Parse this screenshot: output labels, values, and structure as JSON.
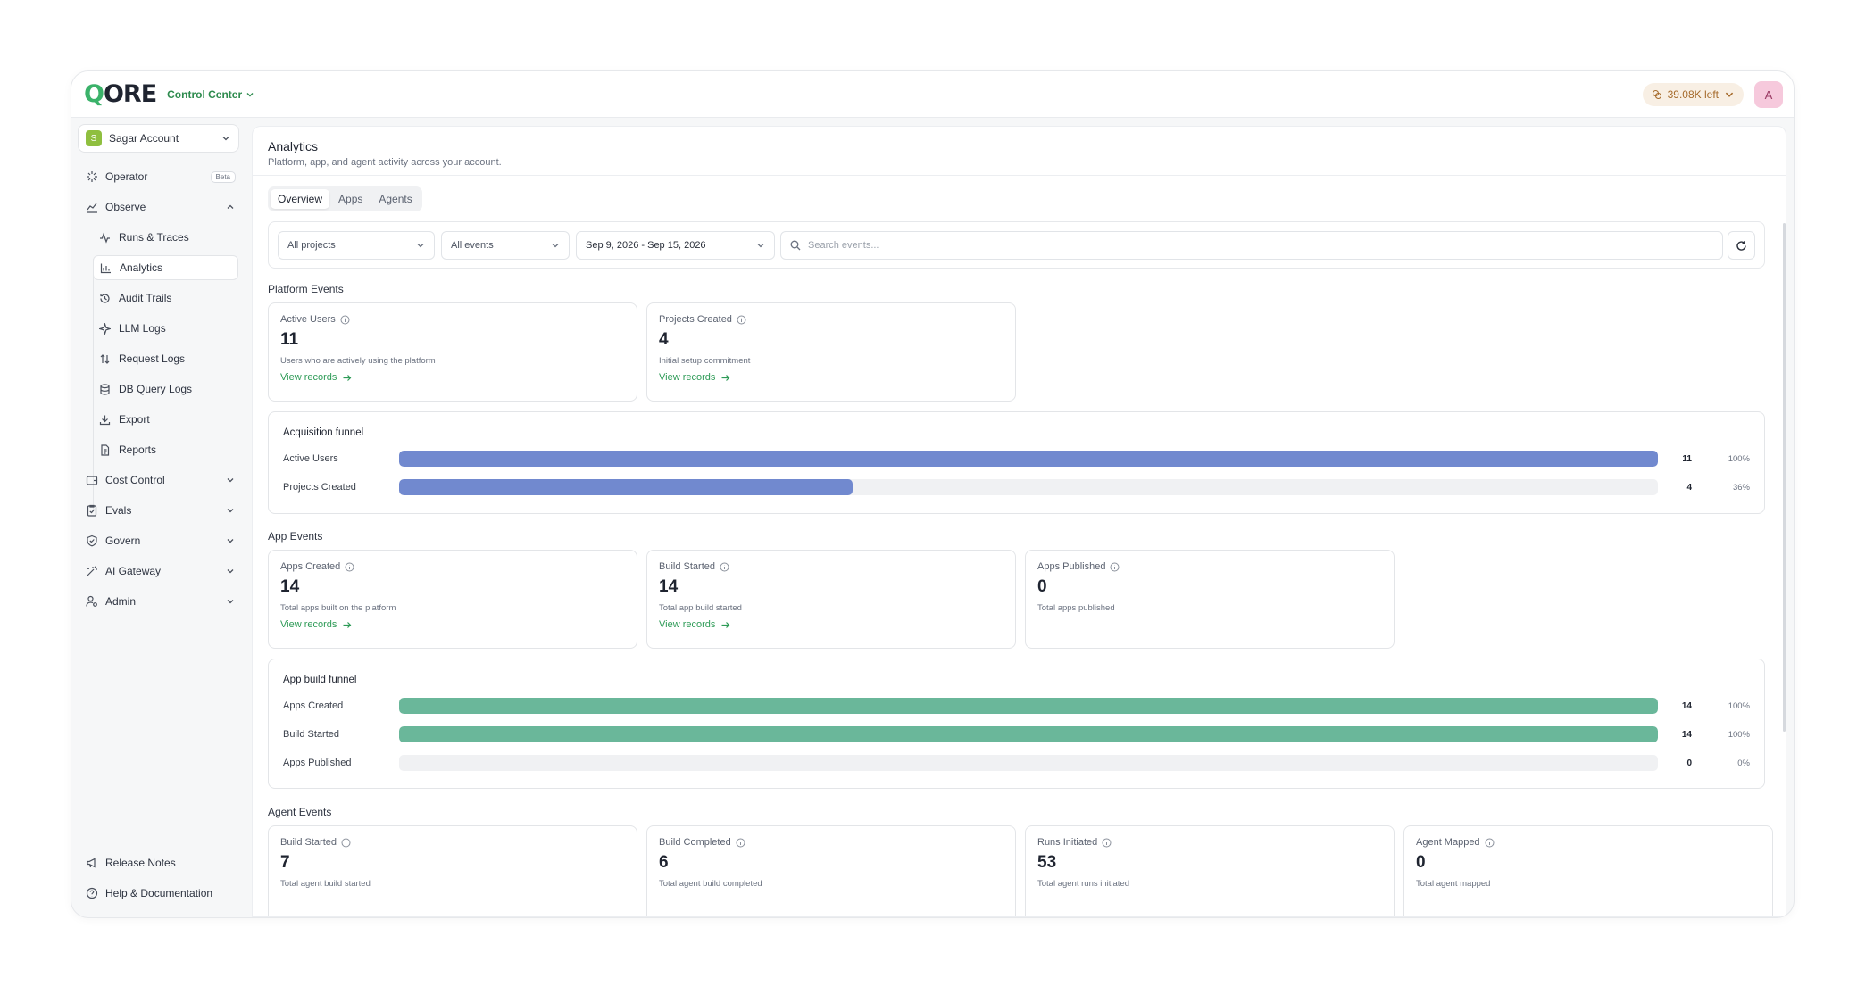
{
  "topbar": {
    "logo_q": "Q",
    "logo_rest": "ORE",
    "section": "Control Center",
    "credits": "39.08K left",
    "avatar": "A"
  },
  "sidebar": {
    "account": {
      "badge": "S",
      "name": "Sagar Account"
    },
    "operator": {
      "label": "Operator",
      "badge": "Beta"
    },
    "observe": {
      "label": "Observe"
    },
    "observe_items": [
      {
        "label": "Runs & Traces"
      },
      {
        "label": "Analytics"
      },
      {
        "label": "Audit Trails"
      },
      {
        "label": "LLM Logs"
      },
      {
        "label": "Request Logs"
      },
      {
        "label": "DB Query Logs"
      },
      {
        "label": "Export"
      },
      {
        "label": "Reports"
      }
    ],
    "groups": [
      {
        "label": "Cost Control"
      },
      {
        "label": "Evals"
      },
      {
        "label": "Govern"
      },
      {
        "label": "AI Gateway"
      },
      {
        "label": "Admin"
      }
    ],
    "footer": [
      {
        "label": "Release Notes"
      },
      {
        "label": "Help & Documentation"
      }
    ]
  },
  "page": {
    "title": "Analytics",
    "subtitle": "Platform, app, and agent activity across your account."
  },
  "tabs": [
    {
      "label": "Overview",
      "active": true
    },
    {
      "label": "Apps"
    },
    {
      "label": "Agents"
    }
  ],
  "filters": {
    "project": "All projects",
    "event": "All events",
    "date": "Sep 9, 2026 - Sep 15, 2026",
    "search_placeholder": "Search events..."
  },
  "platform": {
    "label": "Platform Events",
    "cards": [
      {
        "label": "Active Users",
        "value": "11",
        "desc": "Users who are actively using the platform",
        "link": "View records"
      },
      {
        "label": "Projects Created",
        "value": "4",
        "desc": "Initial setup commitment",
        "link": "View records"
      }
    ],
    "funnel": {
      "title": "Acquisition funnel",
      "rows": [
        {
          "label": "Active Users",
          "count": "11",
          "pct": "100%",
          "fraction": 1.0
        },
        {
          "label": "Projects Created",
          "count": "4",
          "pct": "36%",
          "fraction": 0.36
        }
      ],
      "color": "#7189cf"
    }
  },
  "app": {
    "label": "App Events",
    "cards": [
      {
        "label": "Apps Created",
        "value": "14",
        "desc": "Total apps built on the platform",
        "link": "View records"
      },
      {
        "label": "Build Started",
        "value": "14",
        "desc": "Total app build started",
        "link": "View records"
      },
      {
        "label": "Apps Published",
        "value": "0",
        "desc": "Total apps published"
      }
    ],
    "funnel": {
      "title": "App build funnel",
      "rows": [
        {
          "label": "Apps Created",
          "count": "14",
          "pct": "100%",
          "fraction": 1.0
        },
        {
          "label": "Build Started",
          "count": "14",
          "pct": "100%",
          "fraction": 1.0
        },
        {
          "label": "Apps Published",
          "count": "0",
          "pct": "0%",
          "fraction": 0
        }
      ],
      "color": "#6ab79a"
    }
  },
  "agent": {
    "label": "Agent Events",
    "cards": [
      {
        "label": "Build Started",
        "value": "7",
        "desc": "Total agent build started"
      },
      {
        "label": "Build Completed",
        "value": "6",
        "desc": "Total agent build completed"
      },
      {
        "label": "Runs Initiated",
        "value": "53",
        "desc": "Total agent runs initiated"
      },
      {
        "label": "Agent Mapped",
        "value": "0",
        "desc": "Total agent mapped"
      }
    ]
  }
}
